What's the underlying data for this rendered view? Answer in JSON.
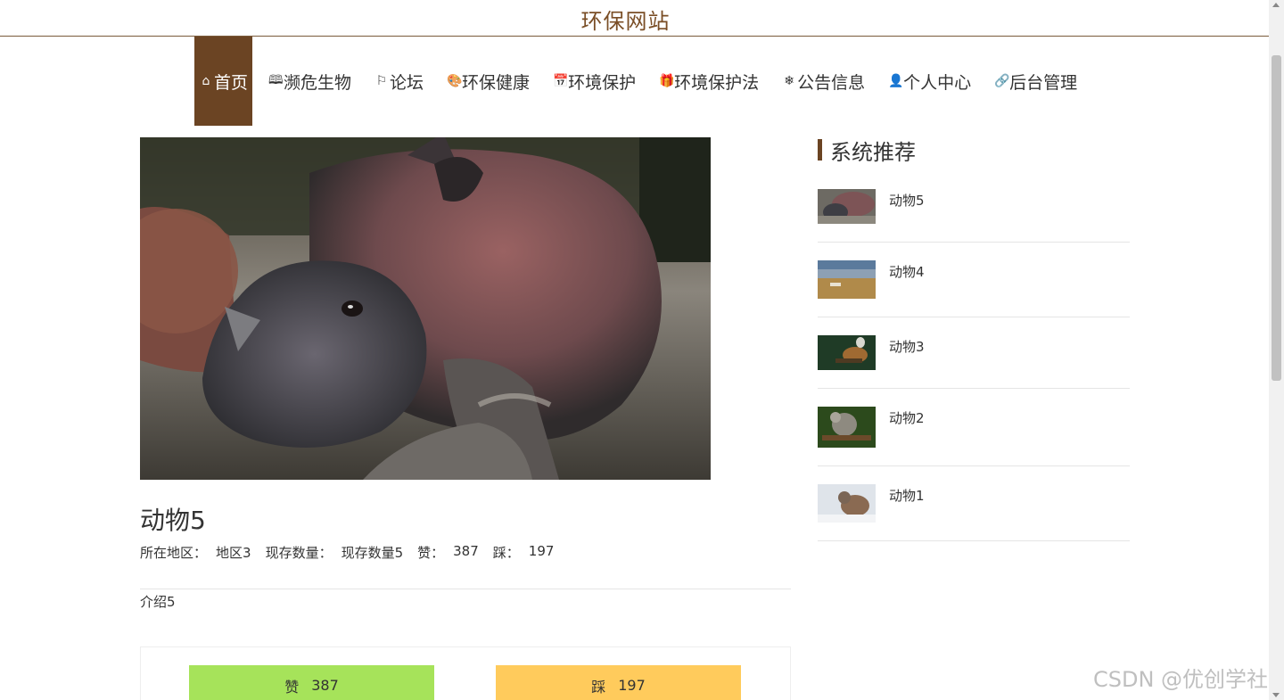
{
  "site": {
    "title": "环保网站"
  },
  "nav": {
    "items": [
      {
        "icon": "home-icon",
        "glyph": "⌂",
        "label": "首页",
        "active": true
      },
      {
        "icon": "book-icon",
        "glyph": "🕮",
        "label": "濒危生物"
      },
      {
        "icon": "flag-icon",
        "glyph": "⚐",
        "label": "论坛"
      },
      {
        "icon": "palette-icon",
        "glyph": "🎨",
        "label": "环保健康"
      },
      {
        "icon": "calendar-icon",
        "glyph": "📅",
        "label": "环境保护"
      },
      {
        "icon": "gift-icon",
        "glyph": "🎁",
        "label": "环境保护法"
      },
      {
        "icon": "snowflake-icon",
        "glyph": "❄",
        "label": "公告信息"
      },
      {
        "icon": "user-icon",
        "glyph": "👤",
        "label": "个人中心"
      },
      {
        "icon": "link-icon",
        "glyph": "🔗",
        "label": "后台管理"
      }
    ]
  },
  "detail": {
    "name": "动物5",
    "region_label": "所在地区：",
    "region_value": "地区3",
    "count_label": "现存数量：",
    "count_value": "现存数量5",
    "like_label": "赞：",
    "like_value": "387",
    "dislike_label": "踩：",
    "dislike_value": "197",
    "intro": "介绍5"
  },
  "vote": {
    "like_label": "赞",
    "like_count": "387",
    "dislike_label": "踩",
    "dislike_count": "197"
  },
  "sidebar": {
    "title": "系统推荐",
    "items": [
      {
        "label": "动物5"
      },
      {
        "label": "动物4"
      },
      {
        "label": "动物3"
      },
      {
        "label": "动物2"
      },
      {
        "label": "动物1"
      }
    ]
  },
  "watermark": "CSDN @优创学社",
  "colors": {
    "brand": "#6b4423",
    "title": "#7a4e26",
    "like": "#a6e35a",
    "dislike": "#ffcb5c"
  }
}
